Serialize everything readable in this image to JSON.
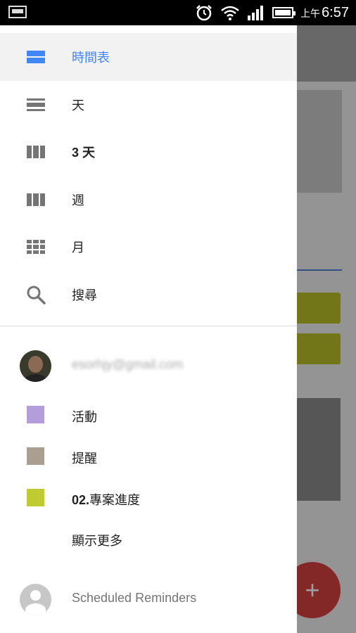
{
  "status_bar": {
    "time_prefix": "上午",
    "time": "6:57"
  },
  "drawer": {
    "views": [
      {
        "label": "時間表",
        "icon": "schedule-view-icon",
        "selected": true
      },
      {
        "label": "天",
        "icon": "day-view-icon"
      },
      {
        "label": "3 天",
        "icon": "three-day-view-icon"
      },
      {
        "label": "週",
        "icon": "week-view-icon"
      },
      {
        "label": "月",
        "icon": "month-view-icon"
      },
      {
        "label": "搜尋",
        "icon": "search-icon"
      }
    ],
    "account": {
      "email": "esorhjy@gmail.com"
    },
    "calendars": [
      {
        "label": "活動",
        "color": "#b39ddb"
      },
      {
        "label": "提醒",
        "color": "#ab9f92"
      },
      {
        "label_prefix": "02.",
        "label": "專案進度",
        "color": "#c0ca33"
      }
    ],
    "show_more": "顯示更多",
    "scheduled_reminders": "Scheduled Reminders"
  },
  "colors": {
    "accent": "#4285f4",
    "fab": "#d64040"
  },
  "fab": {
    "label": "+"
  }
}
